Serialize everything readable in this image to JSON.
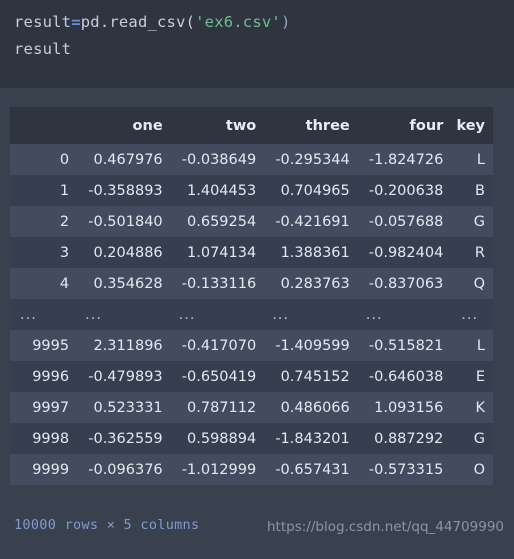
{
  "theme": {
    "code_bg": "#2e3440",
    "output_bg": "#39414f",
    "header_bg": "#2e3440",
    "row_odd_bg": "#434b5e",
    "row_even_bg": "#363e50",
    "text": "#e4e8f0",
    "string_color": "#6fbf8e",
    "operator_color": "#6a8fd8",
    "footer_color": "#7e9ccf",
    "watermark_color": "#8d94a4"
  },
  "code": {
    "line1": {
      "name": "result",
      "operator": "=",
      "call": "pd.read_csv(",
      "string": "'ex6.csv'",
      "close": ")"
    },
    "line2": "result"
  },
  "table": {
    "index_header": "",
    "columns": [
      "one",
      "two",
      "three",
      "four",
      "key"
    ],
    "rows": [
      {
        "index": "0",
        "cells": [
          "0.467976",
          "-0.038649",
          "-0.295344",
          "-1.824726",
          "L"
        ]
      },
      {
        "index": "1",
        "cells": [
          "-0.358893",
          "1.404453",
          "0.704965",
          "-0.200638",
          "B"
        ]
      },
      {
        "index": "2",
        "cells": [
          "-0.501840",
          "0.659254",
          "-0.421691",
          "-0.057688",
          "G"
        ]
      },
      {
        "index": "3",
        "cells": [
          "0.204886",
          "1.074134",
          "1.388361",
          "-0.982404",
          "R"
        ]
      },
      {
        "index": "4",
        "cells": [
          "0.354628",
          "-0.133116",
          "0.283763",
          "-0.837063",
          "Q"
        ]
      },
      {
        "index": "...",
        "cells": [
          "...",
          "...",
          "...",
          "...",
          "..."
        ],
        "ellipsis": true
      },
      {
        "index": "9995",
        "cells": [
          "2.311896",
          "-0.417070",
          "-1.409599",
          "-0.515821",
          "L"
        ]
      },
      {
        "index": "9996",
        "cells": [
          "-0.479893",
          "-0.650419",
          "0.745152",
          "-0.646038",
          "E"
        ]
      },
      {
        "index": "9997",
        "cells": [
          "0.523331",
          "0.787112",
          "0.486066",
          "1.093156",
          "K"
        ]
      },
      {
        "index": "9998",
        "cells": [
          "-0.362559",
          "0.598894",
          "-1.843201",
          "0.887292",
          "G"
        ]
      },
      {
        "index": "9999",
        "cells": [
          "-0.096376",
          "-1.012999",
          "-0.657431",
          "-0.573315",
          "O"
        ]
      }
    ]
  },
  "footer": {
    "shape_text": "10000 rows × 5 columns",
    "watermark": "https://blog.csdn.net/qq_44709990"
  }
}
